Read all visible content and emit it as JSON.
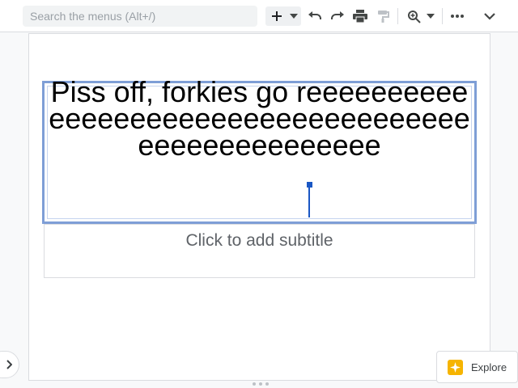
{
  "toolbar": {
    "search_placeholder": "Search the menus (Alt+/)",
    "icons": [
      "plus-icon",
      "dropdown-caret-icon",
      "undo-icon",
      "redo-icon",
      "print-icon",
      "paint-format-icon",
      "zoom-icon",
      "dropdown-caret-icon",
      "more-icon",
      "collapse-chevron-icon"
    ]
  },
  "slide": {
    "title_text": "Piss off, forkies go reeeeeeeeeeeeeeeeeeeeeeeeeeeeeeeeeeeeeeeeeeeeeeeeeee",
    "subtitle_placeholder": "Click to add subtitle"
  },
  "explore": {
    "label": "Explore"
  },
  "colors": {
    "selection_border": "#7e9ed6",
    "caret": "#1a57c4",
    "explore_icon": "#f6b400"
  }
}
